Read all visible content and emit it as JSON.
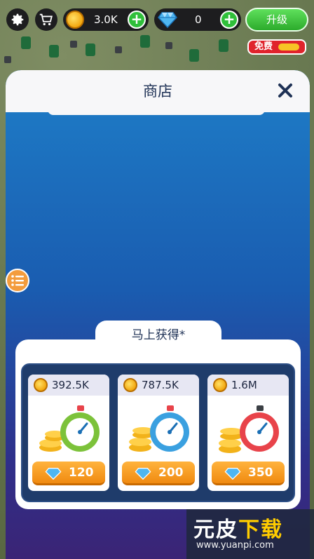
{
  "hud": {
    "coins": "3.0K",
    "gems": "0",
    "upgrade_label": "升级",
    "free_label": "免费"
  },
  "shop": {
    "title": "商店",
    "offer_title": "马上获得*",
    "offers": [
      {
        "coins": "392.5K",
        "price": "120",
        "timer_color": "#7cc23a"
      },
      {
        "coins": "787.5K",
        "price": "200",
        "timer_color": "#3aa0e0"
      },
      {
        "coins": "1.6M",
        "price": "350",
        "timer_color": "#e8434a"
      }
    ]
  },
  "watermark": {
    "brand_part1": "元皮",
    "brand_part2": "下载",
    "url": "www.yuanpi.com"
  },
  "colors": {
    "accent_green": "#2fbf3a",
    "buy_orange": "#f59a1d",
    "badge_red": "#e0232c"
  }
}
